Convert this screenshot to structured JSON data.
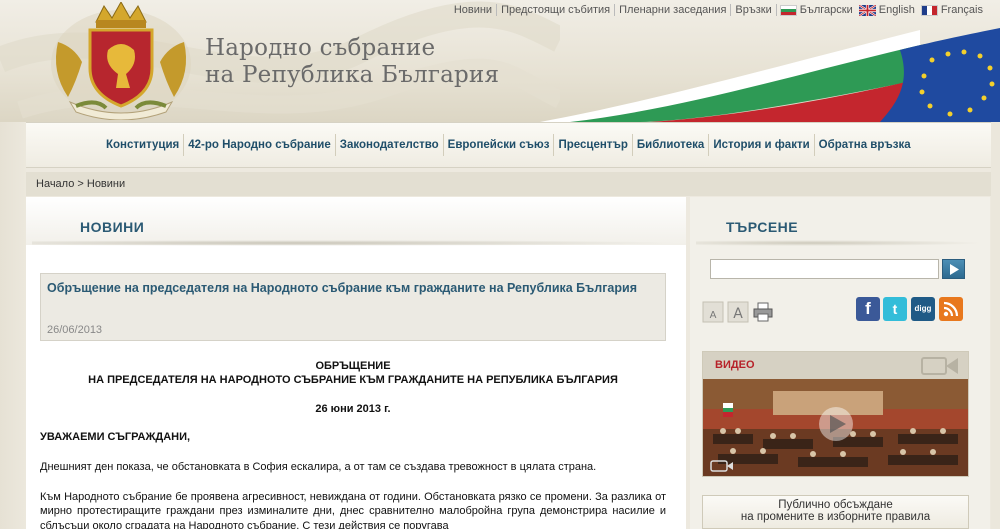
{
  "header": {
    "site_title_line1": "Народно събрание",
    "site_title_line2": "на Република България",
    "top_links": [
      "Новини",
      "Предстоящи събития",
      "Пленарни заседания",
      "Връзки"
    ],
    "languages": [
      {
        "label": "Български",
        "flag": "bulgarian-flag-icon"
      },
      {
        "label": "English",
        "flag": "uk-flag-icon"
      },
      {
        "label": "Français",
        "flag": "french-flag-icon"
      }
    ]
  },
  "nav": {
    "items": [
      "Конституция",
      "42-ро Народно събрание",
      "Законодателство",
      "Европейски съюз",
      "Пресцентър",
      "Библиотека",
      "История и факти",
      "Обратна връзка"
    ]
  },
  "breadcrumb": {
    "home": "Начало",
    "separator": " > ",
    "current": "Новини"
  },
  "content": {
    "section_title": "НОВИНИ",
    "article_title": "Обръщение на председателя на Народното събрание към гражданите на Република България",
    "article_date": "26/06/2013",
    "heading_line1": "ОБРЪЩЕНИЕ",
    "heading_line2": "НА ПРЕДСЕДАТЕЛЯ НА НАРОДНОТО СЪБРАНИЕ КЪМ ГРАЖДАНИТЕ НА РЕПУБЛИКА БЪЛГАРИЯ",
    "date_line": "26 юни 2013 г.",
    "salutation": "УВАЖАЕМИ СЪГРАЖДАНИ,",
    "paragraph1": "Днешният ден показа, че обстановката в София ескалира, а от там се създава тревожност в цялата страна.",
    "paragraph2": "Към Народното събрание бе проявена агресивност, невиждана от години. Обстановката рязко се промени. За разлика от мирно протестиращите граждани през изминалите дни, днес сравнително малобройна група демонстрира насилие и сблъсъци около сградата на Народното събрание. С тези действия се поругава"
  },
  "sidebar": {
    "search_title": "ТЪРСЕНЕ",
    "search_value": "",
    "video_label": "ВИДЕО",
    "public_line1": "Публично обсъждане",
    "public_line2": "на промените в изборните правила"
  },
  "colors": {
    "accent_blue": "#2b5a74",
    "video_red": "#b7222a"
  }
}
